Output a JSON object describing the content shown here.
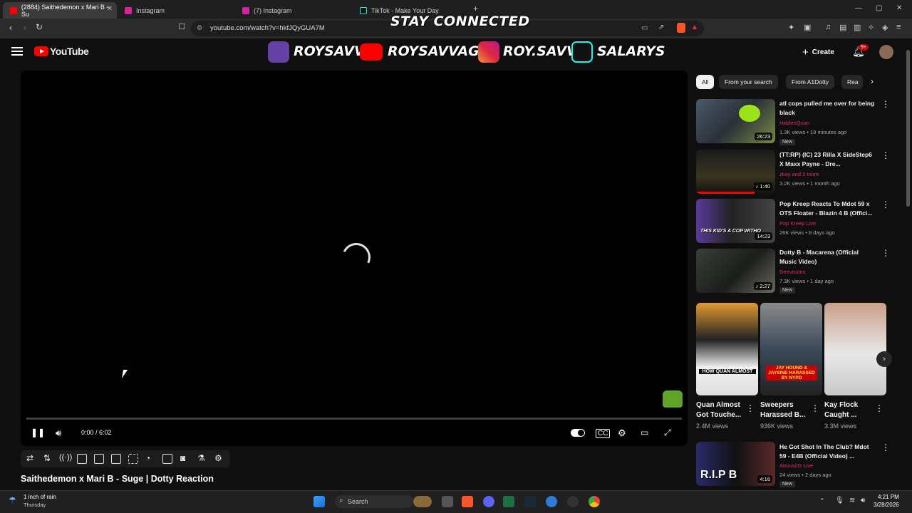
{
  "browser": {
    "tabs": [
      {
        "label": "(2884) Saithedemon x Mari B - Su",
        "active": true
      },
      {
        "label": "Instagram"
      },
      {
        "label": "(7) Instagram"
      },
      {
        "label": "TikTok - Make Your Day"
      }
    ],
    "new_tab": "+",
    "url": "youtube.com/watch?v=hkfJQyGUA7M",
    "window_controls": {
      "minimize": "—",
      "maximize": "▢",
      "close": "✕"
    }
  },
  "overlay": {
    "banner": "STAY CONNECTED",
    "handles": [
      "ROYSAVV",
      "ROYSAVVAGE",
      "ROY.SAVV",
      "SALARYS"
    ]
  },
  "header": {
    "logo": "YouTube",
    "create": "Create",
    "create_icon": "+",
    "notifications_badge": "9+"
  },
  "player": {
    "time": "0:00 / 6:02",
    "title": "Saithedemon x Mari B - Suge | Dotty Reaction"
  },
  "chips": [
    "All",
    "From your search",
    "From A1Dotty",
    "Rea"
  ],
  "chips_next": "›",
  "videos": [
    {
      "title": "atl cops pulled me over for being black",
      "channel": "HiddenQuan",
      "meta": "1.3K views • 19 minutes ago",
      "badge": "New",
      "duration": "26:23"
    },
    {
      "title": "(TT:RP) (IC) 23 Rilla X SideStep6 X Maxx Payne - Dre...",
      "channel": "zkay and 2 more",
      "meta": "3.2K views • 1 month ago",
      "duration": "1:40"
    },
    {
      "title": "Pop Kreep Reacts To Mdot 59 x OTS Floater - Blazin 4 B (Offici...",
      "channel": "Pop Kreep Live",
      "meta": "26K views • 8 days ago",
      "duration": "14:23"
    },
    {
      "title": "Dotty B - Macarena (Official Music Video)",
      "channel": "Deevisions",
      "meta": "7.3K views • 1 day ago",
      "badge": "New",
      "duration": "2:27"
    }
  ],
  "shorts": [
    {
      "title": "Quan Almost Got Touche...",
      "views": "2.4M views"
    },
    {
      "title": "Sweepers Harassed B...",
      "views": "936K views"
    },
    {
      "title": "Kay Flock Caught ...",
      "views": "3.3M views"
    }
  ],
  "shorts_next": "›",
  "video5": {
    "title": "He Got Shot In The Club? Mdot 59 - E4B (Official Video) ...",
    "channel": "Abosa2G Live",
    "meta": "24 views • 2 days ago",
    "badge": "New",
    "duration": "4:16"
  },
  "thumb_text": {
    "t3": "THIS KID'S A COP WITHO",
    "t5": "R.I.P B",
    "s1": "HOW QUAN ALMOST",
    "s2": "JAY HOUND & JAYSINE HARASSED BY NYPD"
  },
  "taskbar": {
    "weather_line1": "1 inch of rain",
    "weather_line2": "Thursday",
    "search": "Search",
    "time": "4:21 PM",
    "date": "3/28/2026"
  },
  "colors": {
    "yt_red": "#ff0000",
    "channel_pink": "#e62e5c",
    "twitch": "#9146ff"
  }
}
